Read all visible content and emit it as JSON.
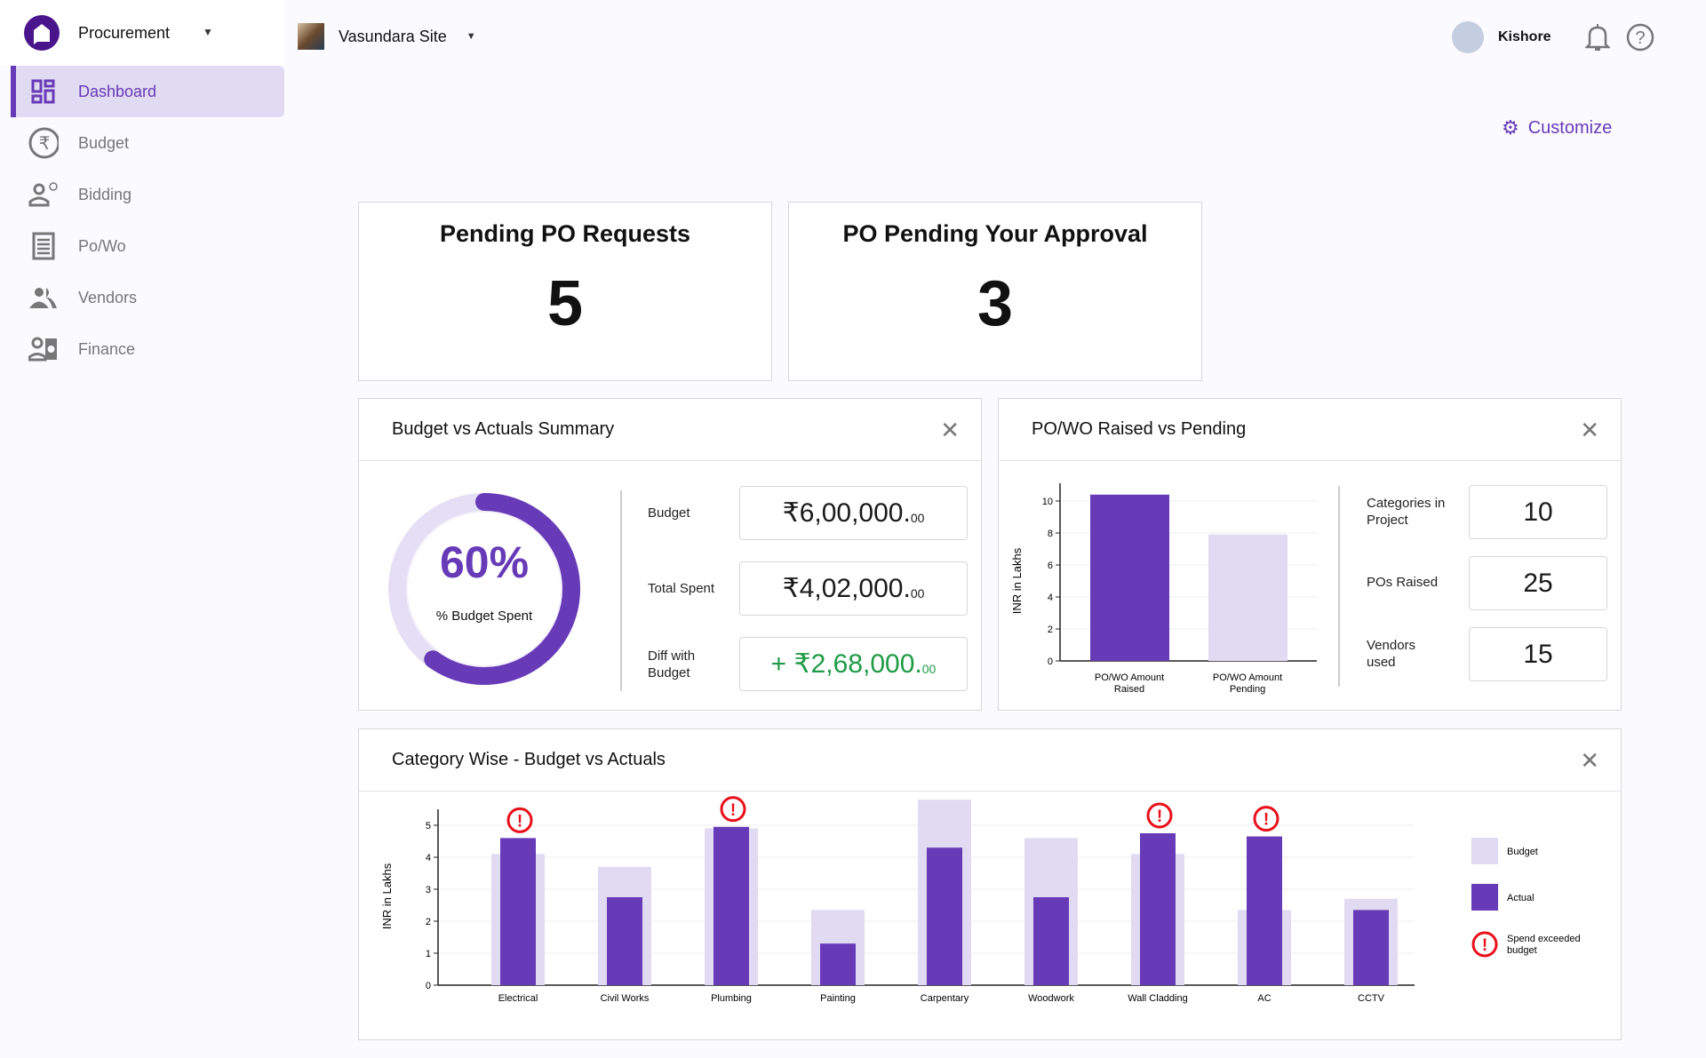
{
  "sidebar": {
    "app_name": "Procurement",
    "items": [
      {
        "label": "Dashboard",
        "icon": "dashboard-icon",
        "active": true
      },
      {
        "label": "Budget",
        "icon": "rupee-icon"
      },
      {
        "label": "Bidding",
        "icon": "bidding-icon"
      },
      {
        "label": "Po/Wo",
        "icon": "receipt-icon"
      },
      {
        "label": "Vendors",
        "icon": "people-icon"
      },
      {
        "label": "Finance",
        "icon": "finance-icon"
      }
    ]
  },
  "header": {
    "site": "Vasundara Site",
    "user": "Kishore",
    "customize": "Customize"
  },
  "stats": [
    {
      "title": "Pending PO Requests",
      "value": "5"
    },
    {
      "title": "PO Pending Your Approval",
      "value": "3"
    }
  ],
  "budget_summary": {
    "title": "Budget vs Actuals Summary",
    "percent": "60%",
    "percent_value": 60,
    "percent_label": "% Budget Spent",
    "rows": [
      {
        "label": "Budget",
        "value": "₹6,00,000.",
        "decimals": "00"
      },
      {
        "label": "Total Spent",
        "value": "₹4,02,000.",
        "decimals": "00"
      },
      {
        "label": "Diff with Budget",
        "value": "+ ₹2,68,000.",
        "decimals": "00"
      }
    ]
  },
  "powo": {
    "title": "PO/WO Raised vs Pending",
    "stats": [
      {
        "label": "Categories in Project",
        "value": "10"
      },
      {
        "label": "POs Raised",
        "value": "25"
      },
      {
        "label": "Vendors used",
        "value": "15"
      }
    ]
  },
  "colors": {
    "accent": "#673ab7",
    "light": "#e0daf2",
    "green": "#1e9b46",
    "warn": "#e8101a"
  },
  "chart_data": [
    {
      "type": "bar",
      "title": "PO/WO Raised vs Pending",
      "ylabel": "INR in Lakhs",
      "ylim": [
        0,
        11
      ],
      "yticks": [
        "0",
        "2",
        "4",
        "6",
        "8",
        "10"
      ],
      "categories": [
        "PO/WO Amount Raised",
        "PO/WO Amount Pending"
      ],
      "values": [
        10.4,
        7.9
      ]
    },
    {
      "type": "bar",
      "title": "Category Wise - Budget vs Actuals",
      "ylabel": "INR in Lakhs",
      "ylim": [
        0,
        5.5
      ],
      "yticks": [
        "0",
        "1",
        "2",
        "3",
        "4",
        "5"
      ],
      "categories": [
        "Electrical",
        "Civil Works",
        "Plumbing",
        "Painting",
        "Carpentary",
        "Woodwork",
        "Wall Cladding",
        "AC",
        "CCTV"
      ],
      "series": [
        {
          "name": "Budget",
          "values": [
            4.1,
            3.7,
            4.9,
            2.35,
            5.8,
            4.6,
            4.1,
            2.35,
            2.7
          ]
        },
        {
          "name": "Actual",
          "values": [
            4.6,
            2.75,
            4.95,
            1.3,
            4.3,
            2.75,
            4.75,
            4.65,
            2.35
          ]
        }
      ],
      "legend": [
        "Budget",
        "Actual",
        "Spend exceeded budget"
      ],
      "legend_position": "right"
    }
  ]
}
